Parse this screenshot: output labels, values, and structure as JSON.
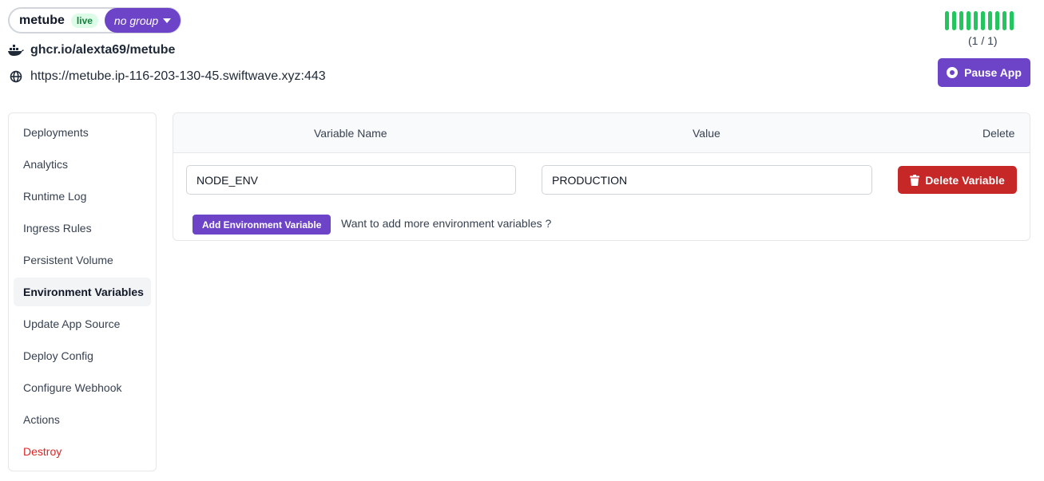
{
  "header": {
    "app_name": "metube",
    "status_badge": "live",
    "group_label": "no group",
    "docker_image": "ghcr.io/alexta69/metube",
    "app_url": "https://metube.ip-116-203-130-45.swiftwave.xyz:443",
    "replica_count": "(1 / 1)",
    "replica_bars": 10,
    "pause_label": "Pause App"
  },
  "sidebar": {
    "items": [
      {
        "label": "Deployments"
      },
      {
        "label": "Analytics"
      },
      {
        "label": "Runtime Log"
      },
      {
        "label": "Ingress Rules"
      },
      {
        "label": "Persistent Volume"
      },
      {
        "label": "Environment Variables",
        "active": true
      },
      {
        "label": "Update App Source"
      },
      {
        "label": "Deploy Config"
      },
      {
        "label": "Configure Webhook"
      },
      {
        "label": "Actions"
      },
      {
        "label": "Destroy",
        "danger": true
      }
    ]
  },
  "env_table": {
    "headers": {
      "name": "Variable Name",
      "value": "Value",
      "delete": "Delete"
    },
    "rows": [
      {
        "name": "NODE_ENV",
        "value": "PRODUCTION",
        "delete_label": "Delete Variable"
      }
    ],
    "add_label": "Add Environment Variable",
    "hint": "Want to add more environment variables ?"
  },
  "colors": {
    "accent": "#6d44c8",
    "danger": "#c62828",
    "success": "#22c55e"
  }
}
